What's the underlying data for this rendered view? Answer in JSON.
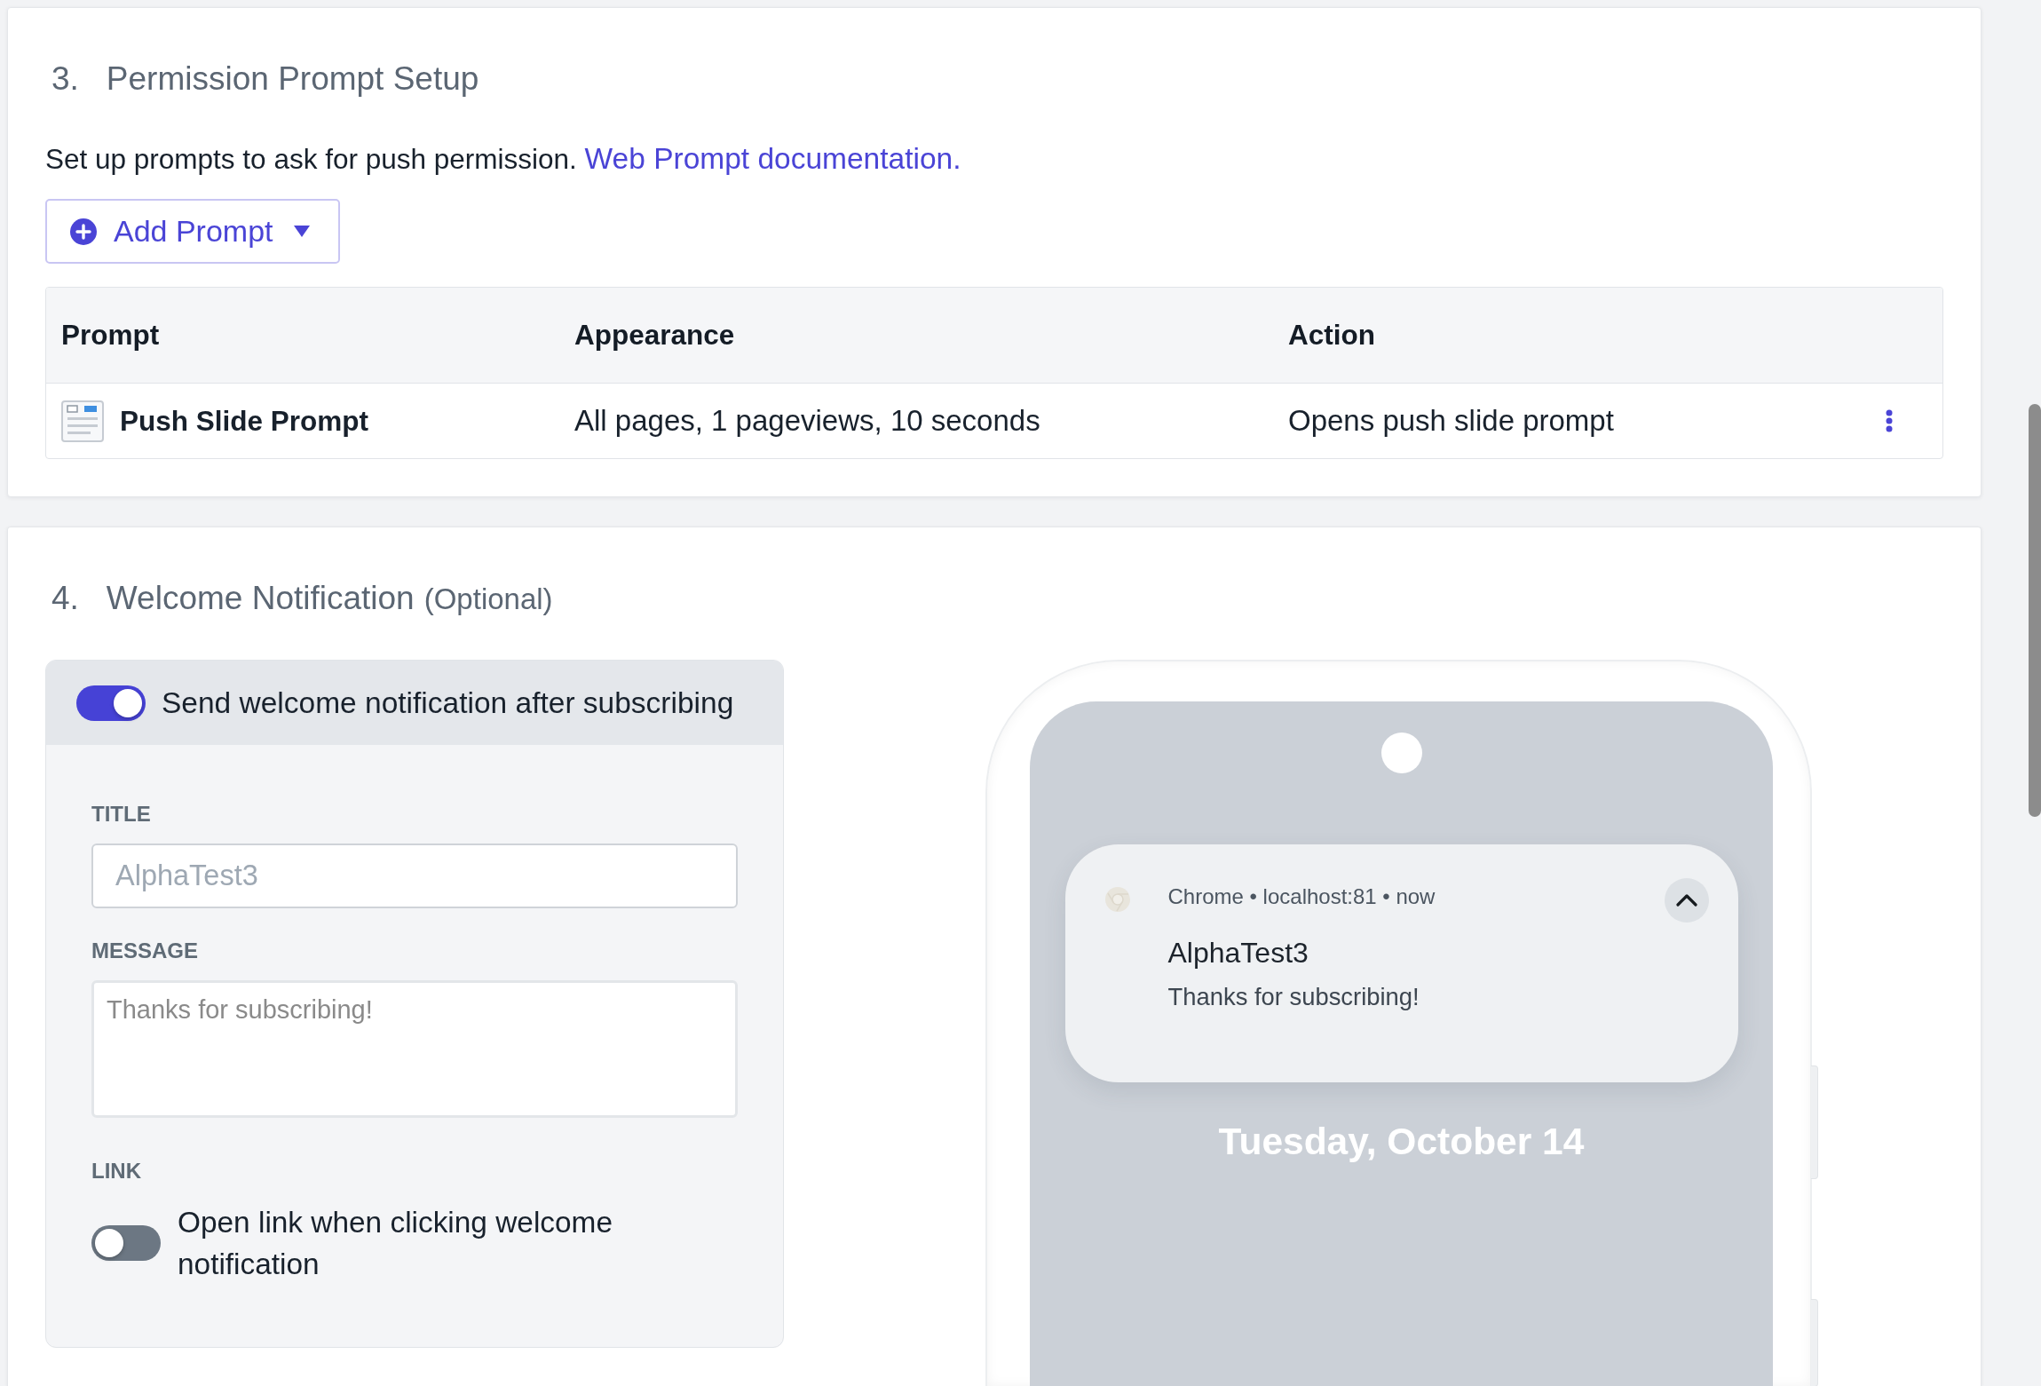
{
  "permission_section": {
    "number": "3.",
    "title": "Permission Prompt Setup",
    "description": "Set up prompts to ask for push permission.",
    "doc_link": "Web Prompt documentation.",
    "add_button": {
      "label": "Add Prompt"
    },
    "table": {
      "columns": [
        "Prompt",
        "Appearance",
        "Action"
      ],
      "rows": [
        {
          "prompt": "Push Slide Prompt",
          "appearance": "All pages, 1 pageviews, 10 seconds",
          "action": "Opens push slide prompt"
        }
      ]
    }
  },
  "welcome_section": {
    "number": "4.",
    "title": "Welcome Notification",
    "note": "(Optional)",
    "send_toggle": {
      "label": "Send welcome notification after subscribing",
      "on": true
    },
    "fields": [
      {
        "kind": "input",
        "label": "TITLE",
        "placeholder": "AlphaTest3"
      },
      {
        "kind": "textarea",
        "label": "MESSAGE",
        "placeholder": "Thanks for subscribing!"
      }
    ],
    "link": {
      "label": "LINK",
      "toggle_label": "Open link when clicking welcome notification",
      "on": false
    },
    "preview": {
      "notification": {
        "source": "Chrome • localhost:81 • now",
        "title": "AlphaTest3",
        "message": "Thanks for subscribing!",
        "expanded": true
      },
      "date": "Tuesday, October 14"
    }
  }
}
